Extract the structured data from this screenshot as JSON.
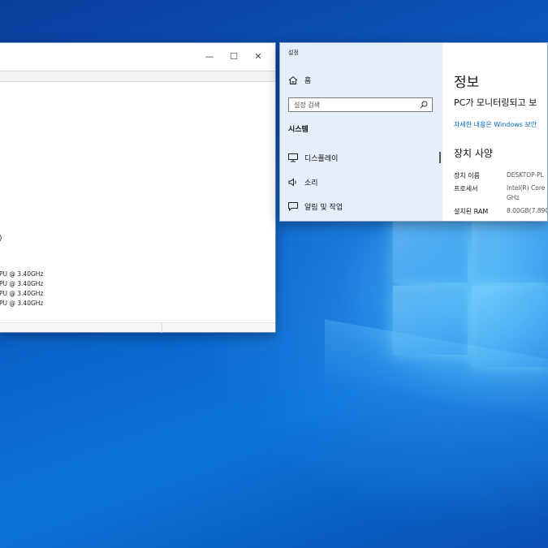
{
  "left_window": {
    "caption": {
      "minimize": "—",
      "maximize": "☐",
      "close": "✕"
    },
    "partial_marker": ")",
    "cpu_lines": [
      "PU @ 3.40GHz",
      "PU @ 3.40GHz",
      "PU @ 3.40GHz",
      "PU @ 3.40GHz"
    ]
  },
  "settings": {
    "app_title": "설정",
    "home_label": "홈",
    "search_placeholder": "설정 검색",
    "section_label": "시스템",
    "nav_items": [
      {
        "label": "디스플레이",
        "icon": "display-icon"
      },
      {
        "label": "소리",
        "icon": "speaker-icon"
      },
      {
        "label": "알림 및 작업",
        "icon": "notification-icon"
      }
    ],
    "page_title": "정보",
    "monitor_text": "PC가 모니터링되고 보",
    "details_link": "자세한 내용은 Windows 보안",
    "spec_title": "장치 사양",
    "specs": [
      {
        "label": "장치 이름",
        "value": "DESKTOP-PL"
      },
      {
        "label": "프로세서",
        "value": "Intel(R) Core"
      },
      {
        "label": "",
        "value": "GHz"
      },
      {
        "label": "설치된 RAM",
        "value": "8.00GB(7.89G"
      }
    ]
  }
}
